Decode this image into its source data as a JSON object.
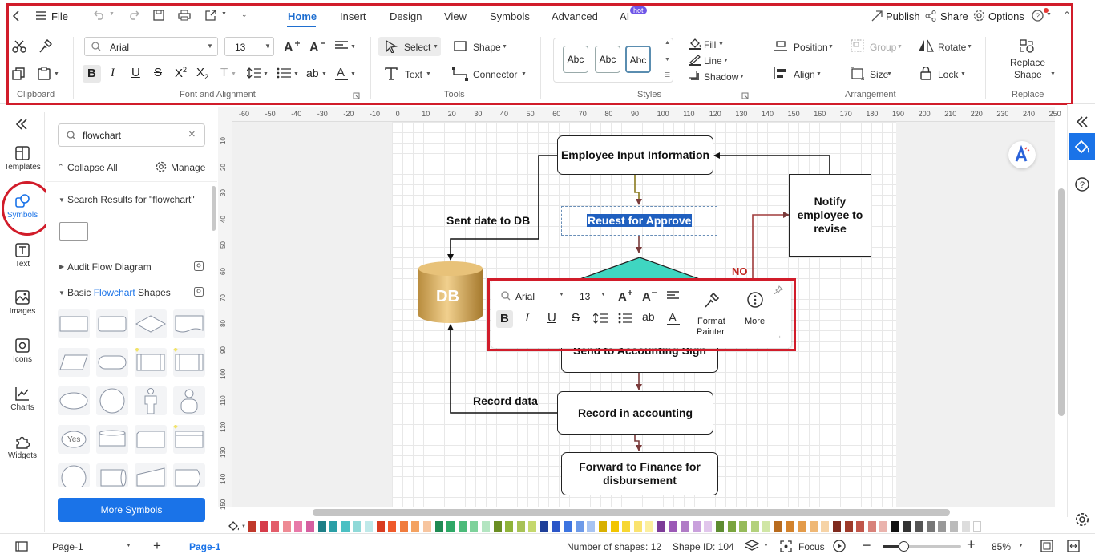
{
  "topbar": {
    "file_label": "File",
    "menu_tabs": [
      "Home",
      "Insert",
      "Design",
      "View",
      "Symbols",
      "Advanced",
      "AI"
    ],
    "ai_badge": "hot",
    "publish_label": "Publish",
    "share_label": "Share",
    "options_label": "Options"
  },
  "ribbon": {
    "font_name": "Arial",
    "font_size": "13",
    "select_label": "Select",
    "shape_label": "Shape",
    "text_label": "Text",
    "connector_label": "Connector",
    "style_sample": "Abc",
    "fill_label": "Fill",
    "line_label": "Line",
    "shadow_label": "Shadow",
    "position_label": "Position",
    "group_label": "Group",
    "rotate_label": "Rotate",
    "align_label": "Align",
    "size_label": "Size",
    "lock_label": "Lock",
    "replace_shape_line1": "Replace",
    "replace_shape_line2": "Shape",
    "groups": {
      "clipboard": "Clipboard",
      "font_alignment": "Font and Alignment",
      "tools": "Tools",
      "styles": "Styles",
      "arrangement": "Arrangement",
      "replace": "Replace"
    }
  },
  "left_rail": {
    "items": [
      "Templates",
      "Symbols",
      "Text",
      "Images",
      "Icons",
      "Charts",
      "Widgets"
    ]
  },
  "library": {
    "search_value": "flowchart",
    "collapse_all": "Collapse All",
    "manage": "Manage",
    "search_results_label": "Search Results for  \"flowchart\"",
    "audit_flow": "Audit Flow Diagram",
    "basic_prefix": "Basic ",
    "basic_highlight": "Flowchart",
    "basic_suffix": " Shapes",
    "yes_shape_label": "Yes",
    "more_symbols": "More Symbols"
  },
  "ruler": {
    "top_ticks": [
      "-60",
      "-50",
      "-40",
      "-30",
      "-20",
      "-10",
      "0",
      "10",
      "20",
      "30",
      "40",
      "50",
      "60",
      "70",
      "80",
      "90",
      "100",
      "110",
      "120",
      "130",
      "140",
      "150",
      "160",
      "170",
      "180",
      "190",
      "200",
      "210",
      "220",
      "230",
      "240",
      "250"
    ],
    "left_ticks": [
      "10",
      "20",
      "30",
      "40",
      "50",
      "60",
      "70",
      "80",
      "90",
      "100",
      "110",
      "120",
      "130",
      "140",
      "150"
    ]
  },
  "diagram": {
    "employee_input": "Employee Input Information",
    "request_approve": "Reuest for Approve",
    "notify": "Notify employee to revise",
    "no_label": "NO",
    "db_label": "DB",
    "sent_date": "Sent date to DB",
    "send_accounting": "Send to Accounting Sign",
    "record_data": "Record data",
    "record_accounting": "Record in  accounting",
    "forward_finance": "Forward to Finance for disbursement"
  },
  "floating_toolbar": {
    "font_name": "Arial",
    "font_size": "13",
    "format_painter_line1": "Format",
    "format_painter_line2": "Painter",
    "more_label": "More"
  },
  "palette": {
    "colors": [
      "#c0392b",
      "#d63c4a",
      "#e35d6a",
      "#ee8a94",
      "#e879a8",
      "#d55fa0",
      "#1e7f87",
      "#2a9fa6",
      "#4cc0c3",
      "#8fd9d8",
      "#bfe9e9",
      "#d93c20",
      "#ef5a2b",
      "#f07c3e",
      "#f4a261",
      "#f7c59f",
      "#1f8a53",
      "#2ea866",
      "#4cbb7a",
      "#7ed29b",
      "#b3e5c1",
      "#6b8e23",
      "#8fb339",
      "#a8c256",
      "#c5d86d",
      "#1f3f99",
      "#2b56c8",
      "#3d74e0",
      "#6d9ae8",
      "#a8c4f2",
      "#d8b000",
      "#f2c500",
      "#f7d732",
      "#fae36f",
      "#fcef9e",
      "#7d3c98",
      "#9b59b6",
      "#b07cc6",
      "#c9a0dc",
      "#e1c6ec",
      "#5e8c31",
      "#7aa43e",
      "#96bb5a",
      "#b3d17c",
      "#d0e6a5",
      "#b86b1e",
      "#d2822c",
      "#e39b4a",
      "#efb876",
      "#f6d3a6",
      "#7f2a1e",
      "#9e3a2a",
      "#c0564a",
      "#d8827a",
      "#eab3ad",
      "#111111",
      "#333333",
      "#555555",
      "#777777",
      "#999999",
      "#bbbbbb",
      "#dddddd",
      "#ffffff"
    ]
  },
  "status": {
    "page_selector": "Page-1",
    "active_page_tab": "Page-1",
    "shape_count": "Number of shapes: 12",
    "shape_id": "Shape ID: 104",
    "focus": "Focus",
    "zoom": "85%",
    "zoom_level": 0.27
  }
}
